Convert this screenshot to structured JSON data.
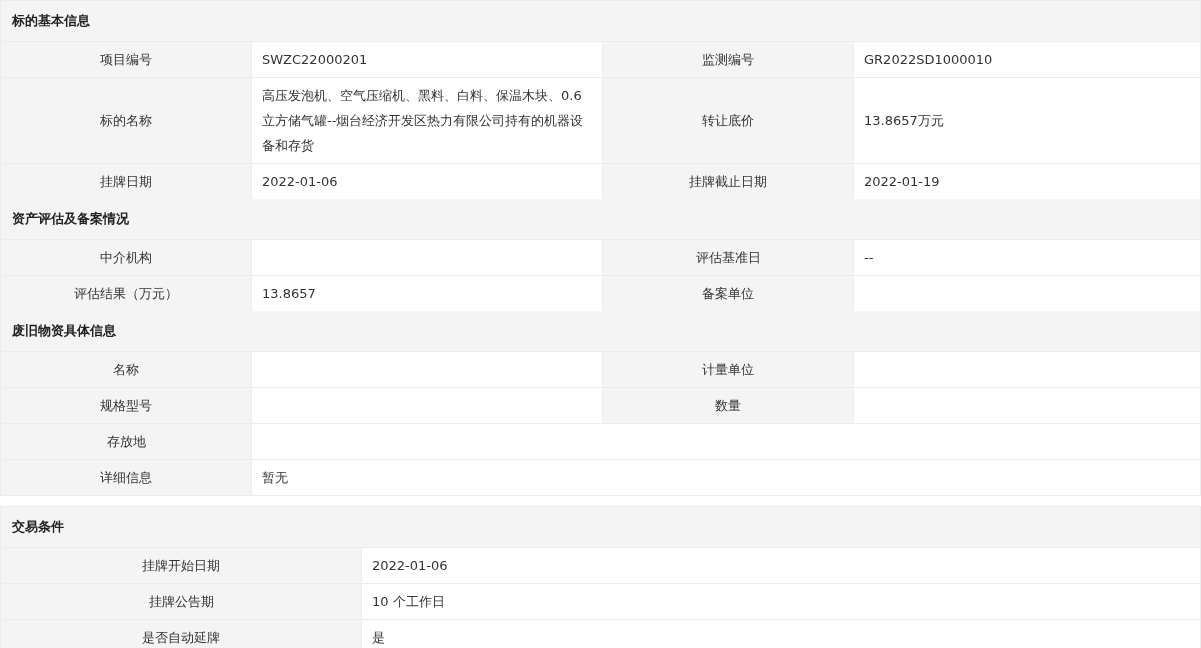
{
  "cards": [
    {
      "kind": "four-column",
      "sections": [
        {
          "title": "标的基本信息",
          "rows": [
            {
              "cells": [
                {
                  "label": "项目编号",
                  "value": "SWZC22000201"
                },
                {
                  "label": "监测编号",
                  "value": "GR2022SD1000010"
                }
              ]
            },
            {
              "cells": [
                {
                  "label": "标的名称",
                  "value": "高压发泡机、空气压缩机、黑料、白料、保温木块、0.6立方储气罐--烟台经济开发区热力有限公司持有的机器设备和存货"
                },
                {
                  "label": "转让底价",
                  "value": "13.8657万元"
                }
              ]
            },
            {
              "cells": [
                {
                  "label": "挂牌日期",
                  "value": "2022-01-06"
                },
                {
                  "label": "挂牌截止日期",
                  "value": "2022-01-19"
                }
              ]
            }
          ]
        },
        {
          "title": "资产评估及备案情况",
          "rows": [
            {
              "cells": [
                {
                  "label": "中介机构"
                },
                {
                  "label": "评估基准日",
                  "value": "--"
                }
              ]
            },
            {
              "cells": [
                {
                  "label": "评估结果（万元）",
                  "value": "13.8657"
                },
                {
                  "label": "备案单位"
                }
              ]
            }
          ]
        },
        {
          "title": "废旧物资具体信息",
          "rows": [
            {
              "cells": [
                {
                  "label": "名称"
                },
                {
                  "label": "计量单位"
                }
              ]
            },
            {
              "cells": [
                {
                  "label": "规格型号"
                },
                {
                  "label": "数量"
                }
              ]
            },
            {
              "cells": [
                {
                  "label": "存放地"
                }
              ]
            },
            {
              "cells": [
                {
                  "label": "详细信息",
                  "value": "暂无"
                }
              ]
            }
          ]
        }
      ]
    },
    {
      "kind": "two-column",
      "sections": [
        {
          "title": "交易条件",
          "rows": [
            {
              "cells": [
                {
                  "label": "挂牌开始日期",
                  "value": "2022-01-06"
                }
              ]
            },
            {
              "cells": [
                {
                  "label": "挂牌公告期",
                  "value": "10 个工作日"
                }
              ]
            },
            {
              "cells": [
                {
                  "label": "是否自动延牌",
                  "value": "是"
                }
              ]
            }
          ]
        }
      ]
    }
  ]
}
